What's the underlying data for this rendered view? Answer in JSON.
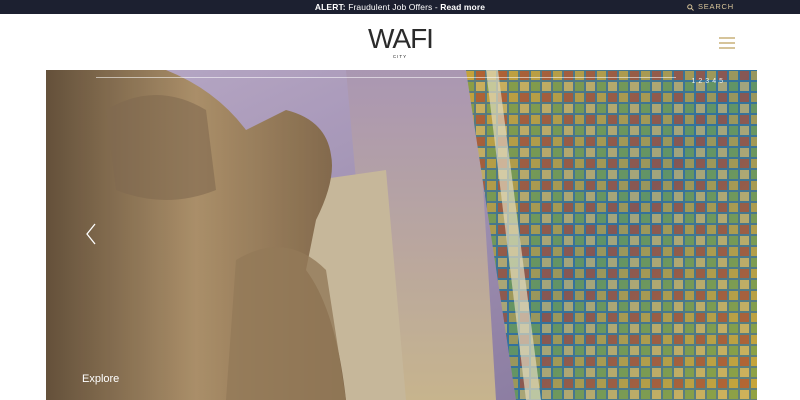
{
  "alert": {
    "label": "ALERT:",
    "message": "Fraudulent Job Offers",
    "separator": "-",
    "link": "Read more"
  },
  "search": {
    "label": "SEARCH",
    "icon": "search-icon"
  },
  "logo": {
    "main": "WAFI",
    "sub": "CITY"
  },
  "menu": {
    "icon": "hamburger-menu-icon"
  },
  "hero": {
    "slides": [
      "1",
      "2",
      "3",
      "4",
      "5"
    ],
    "explore_label": "Explore",
    "prev_icon": "chevron-left-icon"
  },
  "colors": {
    "alert_bg": "#1c2030",
    "accent_gold": "#d6c49a"
  }
}
